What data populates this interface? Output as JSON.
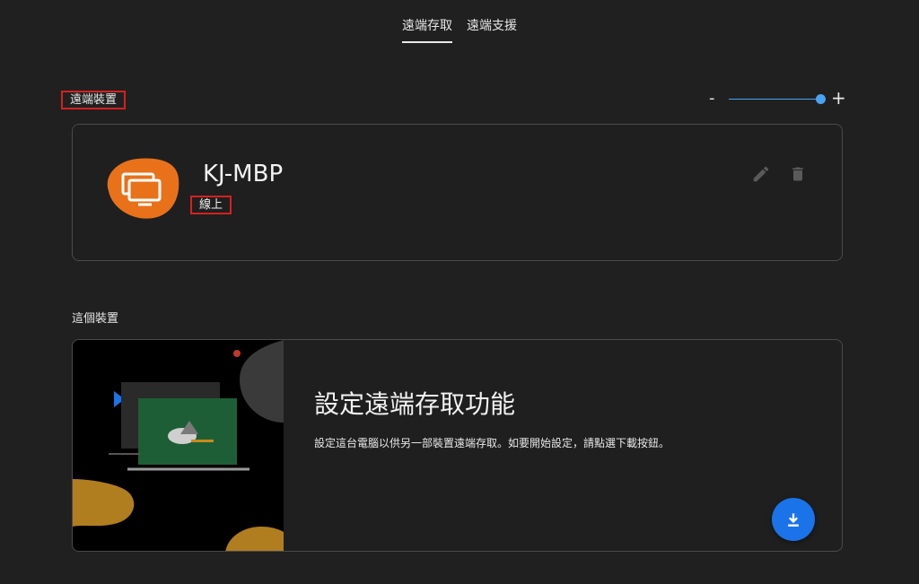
{
  "tabs": [
    {
      "label": "遠端存取",
      "active": true
    },
    {
      "label": "遠端支援",
      "active": false
    }
  ],
  "remote_devices": {
    "section_label": "遠端裝置",
    "zoom": {
      "minus_label": "-",
      "plus_label": "+",
      "level": 1.0
    },
    "device": {
      "name": "KJ-MBP",
      "status": "線上",
      "icon": "monitor-icon",
      "icon_color": "#e8711a"
    }
  },
  "this_device": {
    "section_label": "這個裝置",
    "title": "設定遠端存取功能",
    "description": "設定這台電腦以供另一部裝置遠端存取。如要開始設定，請點選下載按鈕。",
    "download_icon": "download-icon",
    "accent": "#1a73e8"
  }
}
